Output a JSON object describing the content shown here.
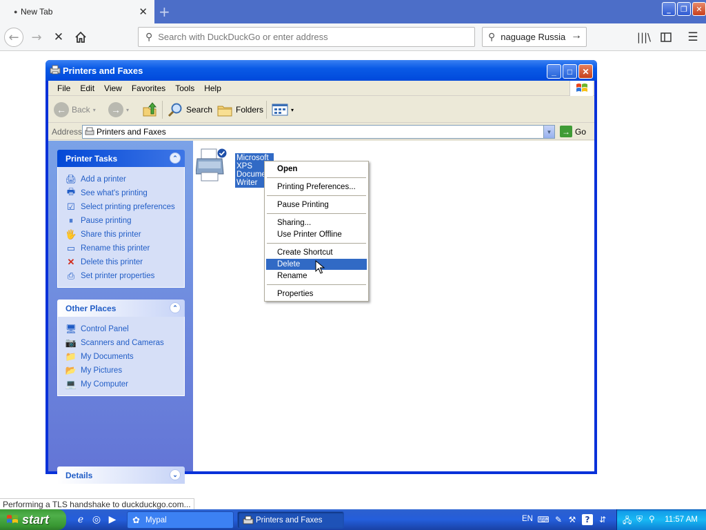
{
  "browser": {
    "tab_title": "New Tab",
    "url_placeholder": "Search with DuckDuckGo or enter address",
    "search_value": "naguage Russia",
    "status_text": "Performing a TLS handshake to duckduckgo.com..."
  },
  "window": {
    "title": "Printers and Faxes",
    "menu": [
      "File",
      "Edit",
      "View",
      "Favorites",
      "Tools",
      "Help"
    ],
    "toolbar": {
      "back": "Back",
      "search": "Search",
      "folders": "Folders"
    },
    "address": {
      "label": "Address",
      "value": "Printers and Faxes",
      "go": "Go"
    }
  },
  "left_pane": {
    "printer_tasks": {
      "title": "Printer Tasks",
      "items": [
        "Add a printer",
        "See what's printing",
        "Select printing preferences",
        "Pause printing",
        "Share this printer",
        "Rename this printer",
        "Delete this printer",
        "Set printer properties"
      ]
    },
    "other_places": {
      "title": "Other Places",
      "items": [
        "Control Panel",
        "Scanners and Cameras",
        "My Documents",
        "My Pictures",
        "My Computer"
      ]
    },
    "details": {
      "title": "Details"
    }
  },
  "content": {
    "printer_name": "Microsoft XPS Document Writer"
  },
  "context_menu": {
    "items": [
      "Open",
      "Printing Preferences...",
      "Pause Printing",
      "Sharing...",
      "Use Printer Offline",
      "Create Shortcut",
      "Delete",
      "Rename",
      "Properties"
    ],
    "highlighted": "Delete"
  },
  "taskbar": {
    "start_label": "start",
    "buttons": [
      "Mypal",
      "Printers and Faxes"
    ],
    "language": "EN",
    "clock": "11:57 AM"
  },
  "colors": {
    "xp_title_blue": "#0a5ae6",
    "selection_blue": "#316ac5",
    "task_link_blue": "#215dc6",
    "start_green": "#3c9b37"
  }
}
